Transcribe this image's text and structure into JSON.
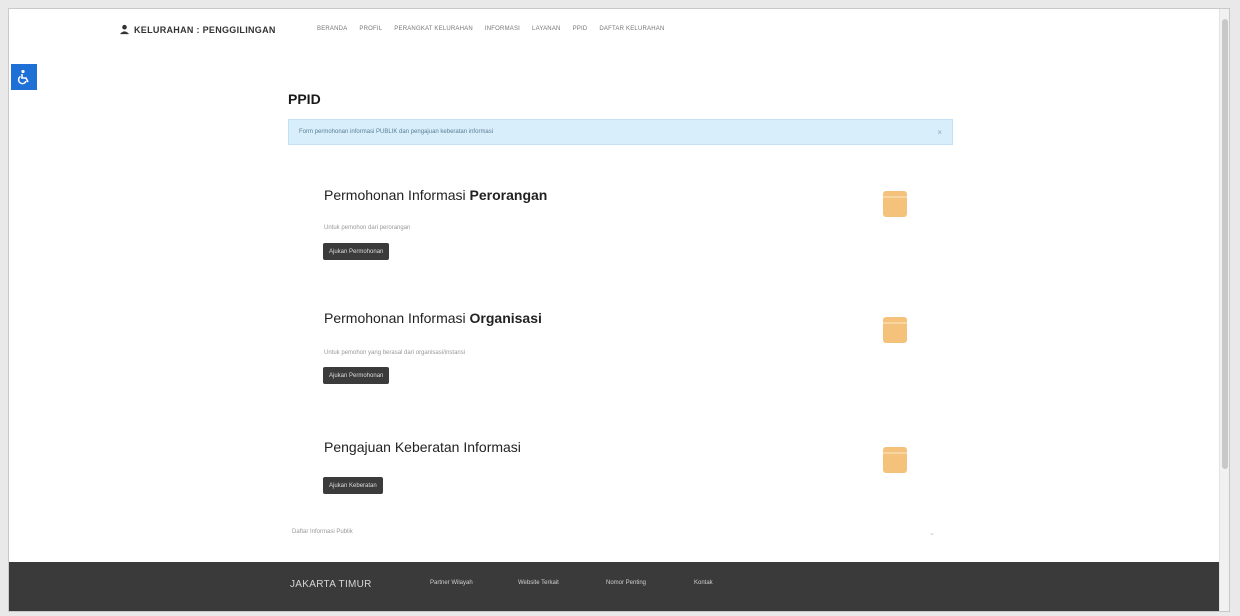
{
  "header": {
    "brand": "KELURAHAN : PENGGILINGAN",
    "menu": [
      {
        "label": "BERANDA"
      },
      {
        "label": "PROFIL"
      },
      {
        "label": "PERANGKAT KELURAHAN"
      },
      {
        "label": "INFORMASI"
      },
      {
        "label": "LAYANAN"
      },
      {
        "label": "PPID"
      },
      {
        "label": "DAFTAR KELURAHAN"
      }
    ]
  },
  "page": {
    "title": "PPID",
    "alert": "Form permohonan informasi PUBLIK dan pengajuan keberatan informasi",
    "alert_close": "×"
  },
  "cards": [
    {
      "title_prefix": "Permohonan Informasi ",
      "title_bold": "Perorangan",
      "description": "Untuk pemohon dari perorangan",
      "button": "Ajukan Permohonan"
    },
    {
      "title_prefix": "Permohonan Informasi ",
      "title_bold": "Organisasi",
      "description": "Untuk pemohon yang berasal dari organisasi/instansi",
      "button": "Ajukan Permohonan"
    },
    {
      "title_prefix": "Pengajuan Keberatan Informasi",
      "title_bold": "",
      "description": "",
      "button": "Ajukan Keberatan"
    }
  ],
  "daftar": {
    "label": "Daftar Informasi Publik",
    "chevron": "⌄"
  },
  "footer": {
    "brand": "JAKARTA TIMUR",
    "links": [
      {
        "label": "Partner Wilayah"
      },
      {
        "label": "Website Terkait"
      },
      {
        "label": "Nomor Penting"
      },
      {
        "label": "Kontak"
      }
    ]
  },
  "colors": {
    "accent": "#1e6fd6",
    "alert_bg": "#d9eefb",
    "card_icon": "#f4c27a",
    "footer_bg": "#3a3a3a"
  }
}
